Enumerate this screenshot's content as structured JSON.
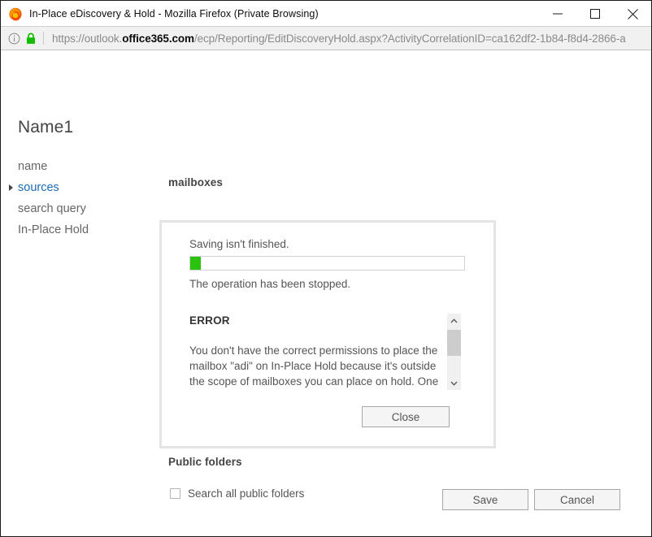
{
  "window": {
    "title": "In-Place eDiscovery & Hold - Mozilla Firefox (Private Browsing)",
    "app_icon": "firefox-logo-icon",
    "controls": {
      "minimize": "minimize-icon",
      "maximize": "maximize-icon",
      "close": "close-icon"
    }
  },
  "urlbar": {
    "info_icon": "page-info-icon",
    "lock_icon": "padlock-icon",
    "url_prefix": "https://outlook.",
    "url_host": "office365.com",
    "url_path": "/ecp/Reporting/EditDiscoveryHold.aspx?ActivityCorrelationID=ca162df2-1b84-f8d4-2866-a",
    "url_full": "https://outlook.office365.com/ecp/Reporting/EditDiscoveryHold.aspx?ActivityCorrelationID=ca162df2-1b84-f8d4-2866-a"
  },
  "form": {
    "title": "Name1",
    "nav": [
      {
        "label": "name",
        "active": false,
        "arrow": false
      },
      {
        "label": "sources",
        "active": true,
        "arrow": true
      },
      {
        "label": "search query",
        "active": false,
        "arrow": false
      },
      {
        "label": "In-Place Hold",
        "active": false,
        "arrow": false
      }
    ],
    "sections": {
      "mailboxes_label": "mailboxes",
      "public_folders_label": "Public folders"
    },
    "public_folders_checkbox": {
      "label": "Search all public folders",
      "checked": false
    },
    "buttons": {
      "save": "Save",
      "cancel": "Cancel"
    }
  },
  "dialog": {
    "status": "Saving isn't finished.",
    "progress_percent": 4,
    "substatus": "The operation has been stopped.",
    "error_title": "ERROR",
    "error_body": "You don't have the correct permissions to place the mailbox \"adi\" on In-Place Hold because it's outside the scope of mailboxes you can place on hold. One possible reason is the",
    "close_label": "Close",
    "scrollbar": {
      "up_icon": "chevron-up-icon",
      "down_icon": "chevron-down-icon"
    }
  },
  "colors": {
    "accent_link": "#1a6bb5",
    "progress_green": "#2bc20e",
    "lock_green": "#12bc00",
    "dialog_border": "#e4e4e4"
  }
}
